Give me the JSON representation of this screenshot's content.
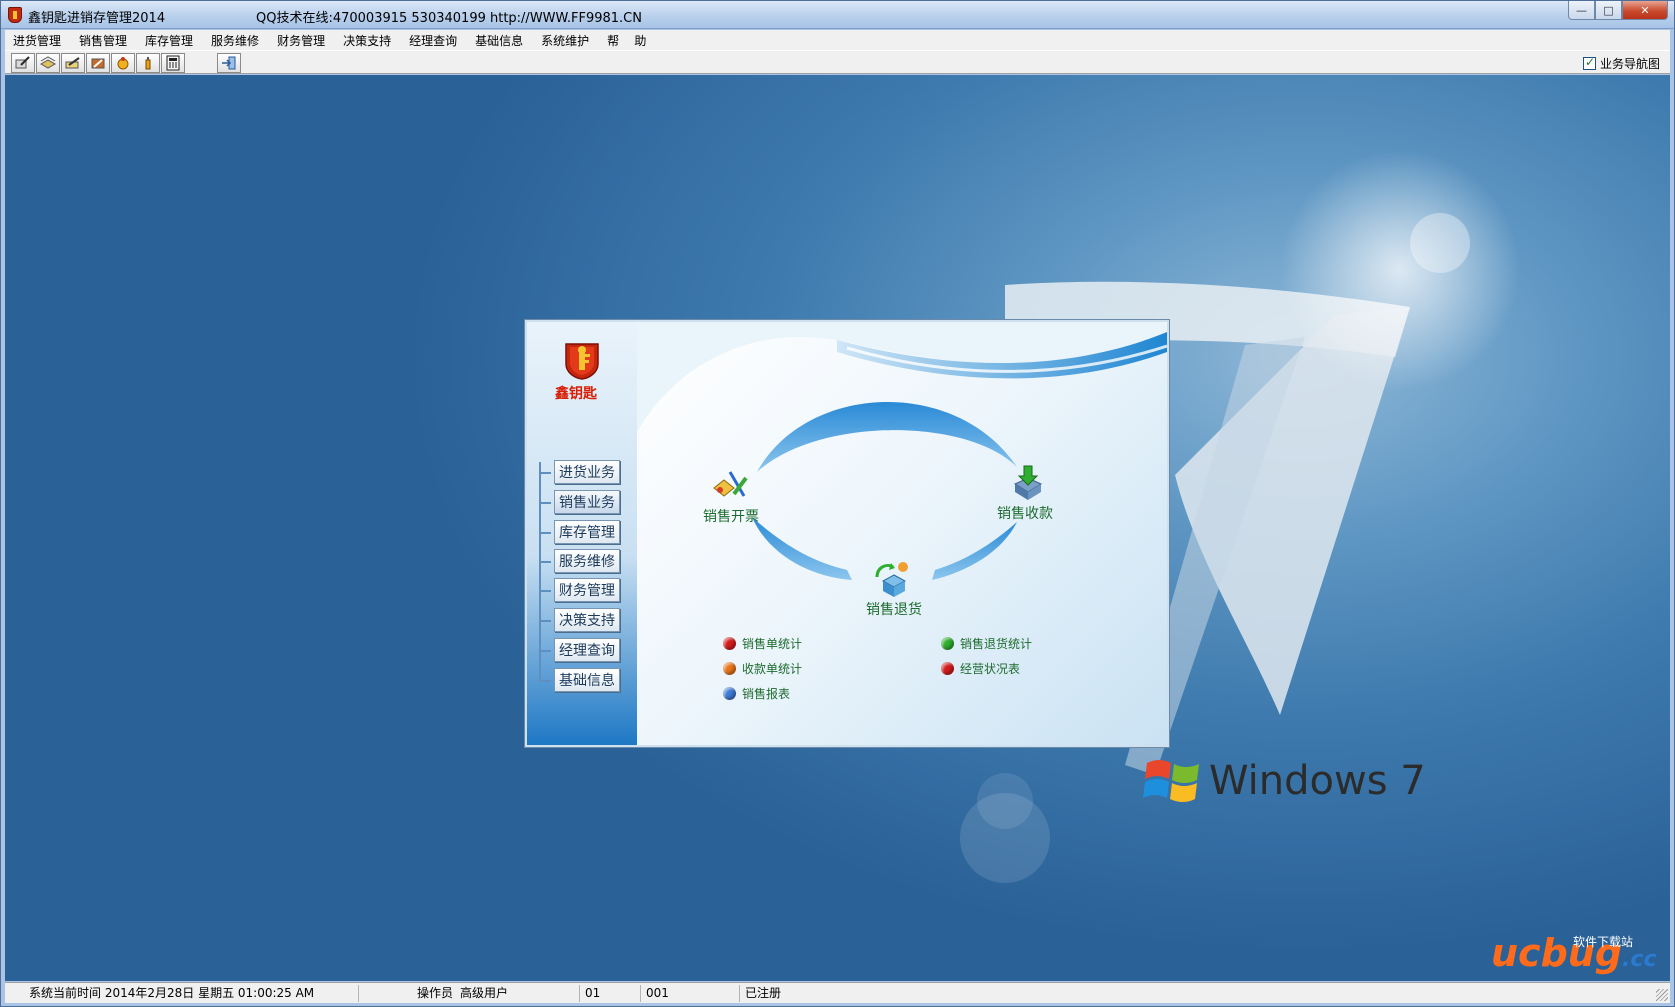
{
  "window": {
    "title": "鑫钥匙进销存管理2014",
    "info": "QQ技术在线:470003915  530340199  http://WWW.FF9981.CN",
    "min_glyph": "—",
    "max_glyph": "□",
    "close_glyph": "✕"
  },
  "menu": [
    "进货管理",
    "销售管理",
    "库存管理",
    "服务维修",
    "财务管理",
    "决策支持",
    "经理查询",
    "基础信息",
    "系统维护",
    "帮    助"
  ],
  "toolbar": {
    "nav_checkbox_label": "业务导航图",
    "nav_checked": true
  },
  "panel": {
    "brand": "鑫钥匙",
    "nav_buttons": [
      "进货业务",
      "销售业务",
      "库存管理",
      "服务维修",
      "财务管理",
      "决策支持",
      "经理查询",
      "基础信息"
    ],
    "active_nav": "销售业务",
    "flow": {
      "invoice": "销售开票",
      "receipt": "销售收款",
      "return": "销售退货"
    },
    "reports": [
      {
        "label": "销售单统计",
        "color": "#d41c1c"
      },
      {
        "label": "收款单统计",
        "color": "#e8751a"
      },
      {
        "label": "销售报表",
        "color": "#3d7ad6"
      },
      {
        "label": "销售退货统计",
        "color": "#2fae2f"
      },
      {
        "label": "经营状况表",
        "color": "#d41c1c"
      }
    ]
  },
  "desktop": {
    "os_brand": "Windows 7"
  },
  "statusbar": {
    "time": "系统当前时间  2014年2月28日  星期五  01:00:25 AM",
    "operator_label": "操作员",
    "operator": "高级用户",
    "code1": "01",
    "code2": "001",
    "reg": "已注册"
  },
  "watermark": {
    "main": "ucbug",
    "sub": "软件下载站",
    "tld": ".cc"
  },
  "colors": {
    "accent": "#1e78c4",
    "flow_green": "#1d6b2d",
    "brand_red": "#d81e06"
  }
}
